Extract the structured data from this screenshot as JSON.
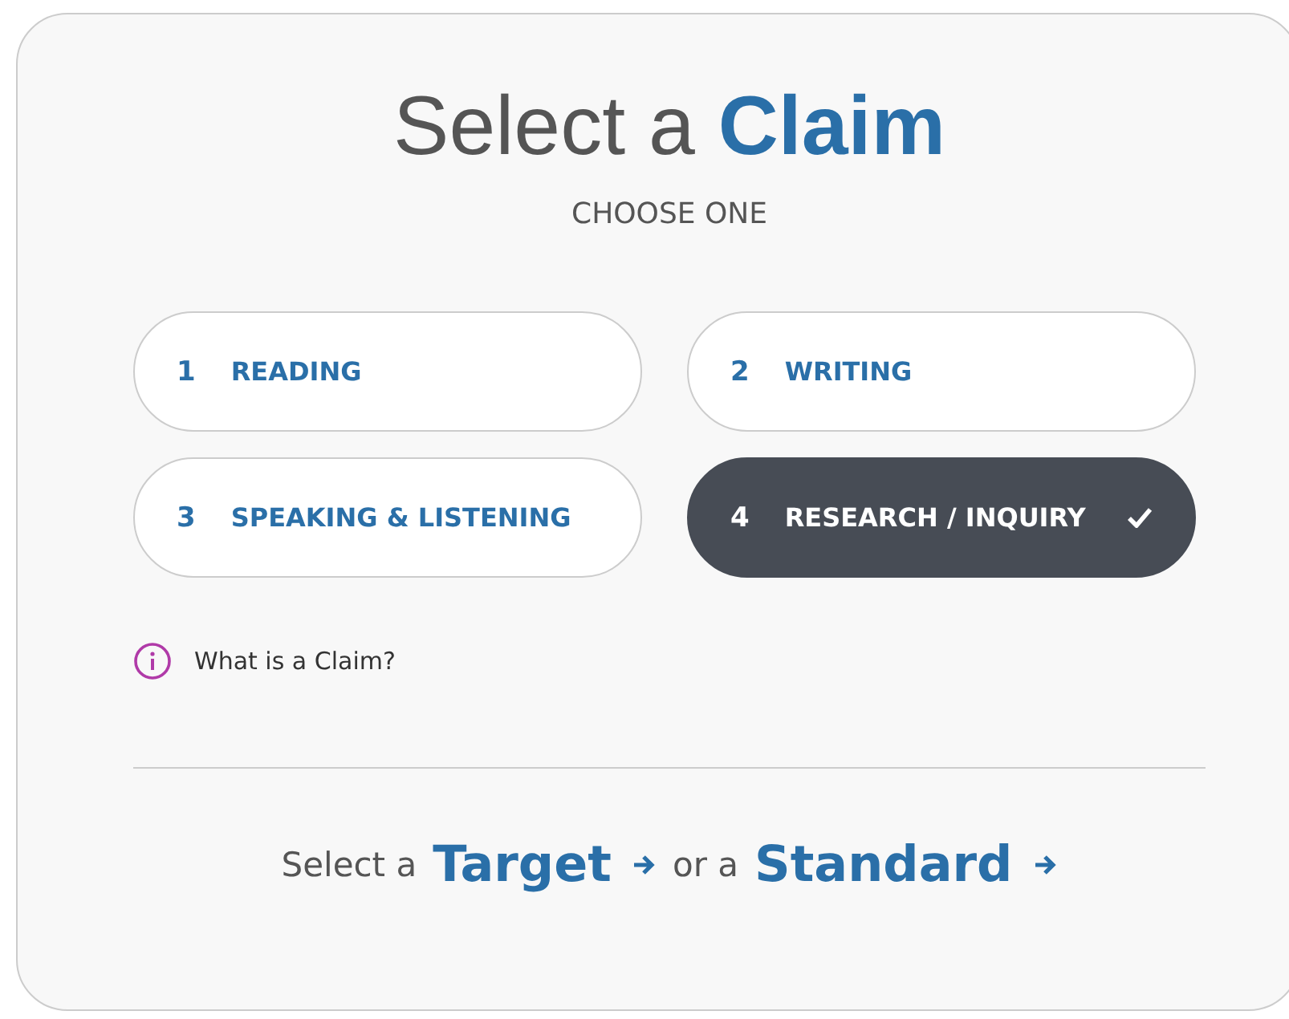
{
  "title": "Select a **Claim**",
  "subtitle": "CHOOSE ONE",
  "claims": [
    {
      "number": "1",
      "label": "READING",
      "selected": false
    },
    {
      "number": "2",
      "label": "WRITING",
      "selected": false
    },
    {
      "number": "3",
      "label": "SPEAKING & LISTENING",
      "selected": false
    },
    {
      "number": "4",
      "label": "RESEARCH / INQUIRY",
      "selected": true
    }
  ],
  "info_link": "What is a Claim?",
  "footer": {
    "prefix": "Select a",
    "target_link": "Target",
    "middle": "or a",
    "standard_link": "Standard"
  }
}
